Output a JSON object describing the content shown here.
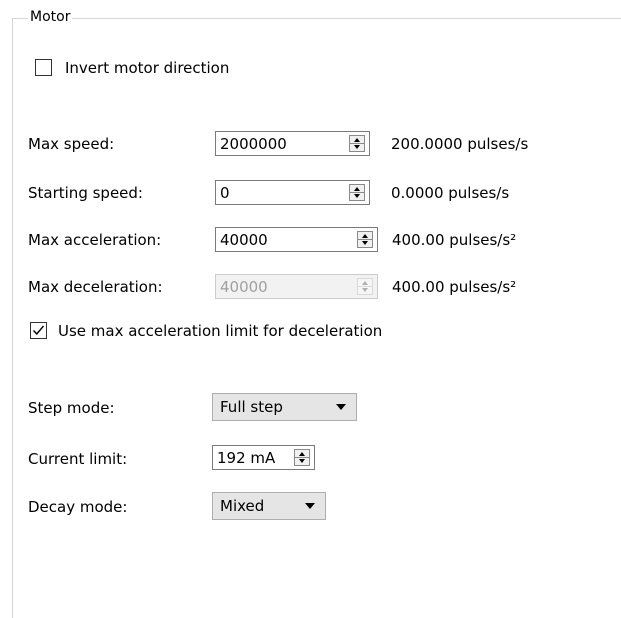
{
  "group": {
    "title": "Motor"
  },
  "invert": {
    "label": "Invert motor direction",
    "checked": false
  },
  "rows": [
    {
      "label": "Max speed:",
      "value": "2000000",
      "unit": "200.0000 pulses/s",
      "disabled": false
    },
    {
      "label": "Starting speed:",
      "value": "0",
      "unit": "0.0000 pulses/s",
      "disabled": false
    },
    {
      "label": "Max acceleration:",
      "value": "40000",
      "unit": "400.00 pulses/s²",
      "disabled": false
    },
    {
      "label": "Max deceleration:",
      "value": "40000",
      "unit": "400.00 pulses/s²",
      "disabled": true
    }
  ],
  "use_max_accel": {
    "label": "Use max acceleration limit for deceleration",
    "checked": true
  },
  "step_mode": {
    "label": "Step mode:",
    "value": "Full step"
  },
  "current_limit": {
    "label": "Current limit:",
    "value": "192 mA"
  },
  "decay_mode": {
    "label": "Decay mode:",
    "value": "Mixed"
  }
}
